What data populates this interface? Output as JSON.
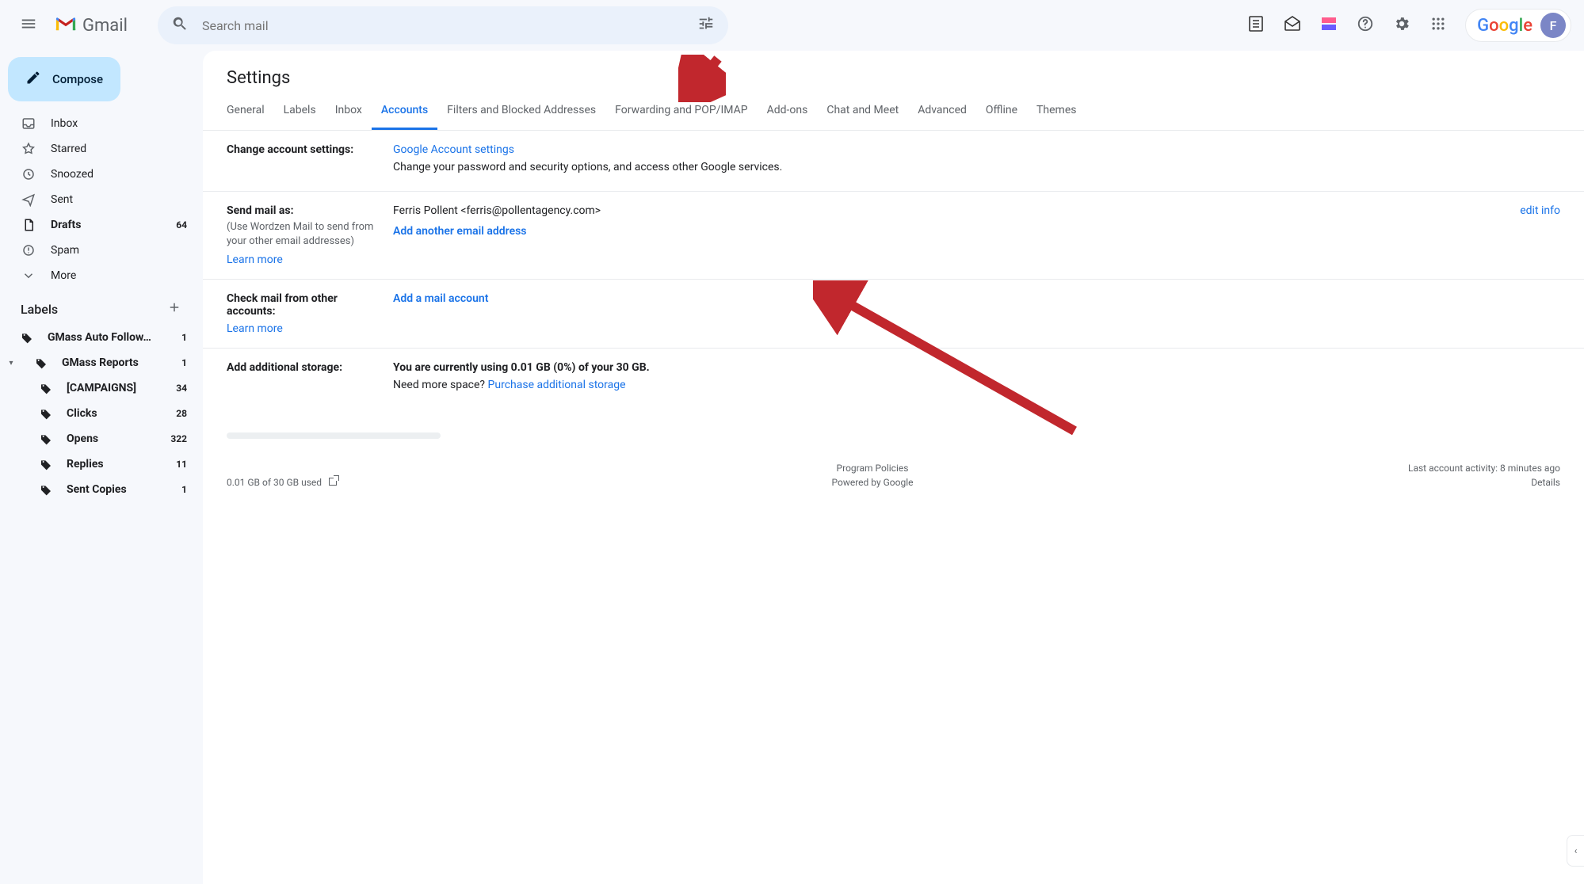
{
  "header": {
    "product": "Gmail",
    "search_placeholder": "Search mail",
    "avatar_initial": "F"
  },
  "sidebar": {
    "compose": "Compose",
    "nav": [
      {
        "name": "inbox",
        "label": "Inbox",
        "count": "",
        "bold": false
      },
      {
        "name": "starred",
        "label": "Starred",
        "count": "",
        "bold": false
      },
      {
        "name": "snoozed",
        "label": "Snoozed",
        "count": "",
        "bold": false
      },
      {
        "name": "sent",
        "label": "Sent",
        "count": "",
        "bold": false
      },
      {
        "name": "drafts",
        "label": "Drafts",
        "count": "64",
        "bold": true
      },
      {
        "name": "spam",
        "label": "Spam",
        "count": "",
        "bold": false
      },
      {
        "name": "more",
        "label": "More",
        "count": "",
        "bold": false
      }
    ],
    "labels_header": "Labels",
    "labels": [
      {
        "name": "gmass-auto-follow",
        "label": "GMass Auto Follow…",
        "count": "1",
        "bold": true,
        "child": false,
        "caret": false
      },
      {
        "name": "gmass-reports",
        "label": "GMass Reports",
        "count": "1",
        "bold": true,
        "child": false,
        "caret": true
      },
      {
        "name": "campaigns",
        "label": "[CAMPAIGNS]",
        "count": "34",
        "bold": true,
        "child": true,
        "caret": false
      },
      {
        "name": "clicks",
        "label": "Clicks",
        "count": "28",
        "bold": true,
        "child": true,
        "caret": false
      },
      {
        "name": "opens",
        "label": "Opens",
        "count": "322",
        "bold": true,
        "child": true,
        "caret": false
      },
      {
        "name": "replies",
        "label": "Replies",
        "count": "11",
        "bold": true,
        "child": true,
        "caret": false
      },
      {
        "name": "sent-copies",
        "label": "Sent Copies",
        "count": "1",
        "bold": true,
        "child": true,
        "caret": false
      }
    ]
  },
  "settings": {
    "title": "Settings",
    "tabs": [
      "General",
      "Labels",
      "Inbox",
      "Accounts",
      "Filters and Blocked Addresses",
      "Forwarding and POP/IMAP",
      "Add-ons",
      "Chat and Meet",
      "Advanced",
      "Offline",
      "Themes"
    ],
    "active_tab": "Accounts",
    "change_account": {
      "heading": "Change account settings:",
      "link": "Google Account settings",
      "desc": "Change your password and security options, and access other Google services."
    },
    "send_mail_as": {
      "heading": "Send mail as:",
      "sub": "(Use Wordzen Mail to send from your other email addresses)",
      "learn_more": "Learn more",
      "identity": "Ferris Pollent <ferris@pollentagency.com>",
      "edit": "edit info",
      "add_link": "Add another email address"
    },
    "check_mail": {
      "heading": "Check mail from other accounts:",
      "learn_more": "Learn more",
      "link": "Add a mail account"
    },
    "storage": {
      "heading": "Add additional storage:",
      "line1": "You are currently using 0.01 GB (0%) of your 30 GB.",
      "line2_prefix": "Need more space? ",
      "line2_link": "Purchase additional storage"
    }
  },
  "footer": {
    "usage": "0.01 GB of 30 GB used",
    "program_policies": "Program Policies",
    "powered": "Powered by Google",
    "activity": "Last account activity: 8 minutes ago",
    "details": "Details"
  }
}
